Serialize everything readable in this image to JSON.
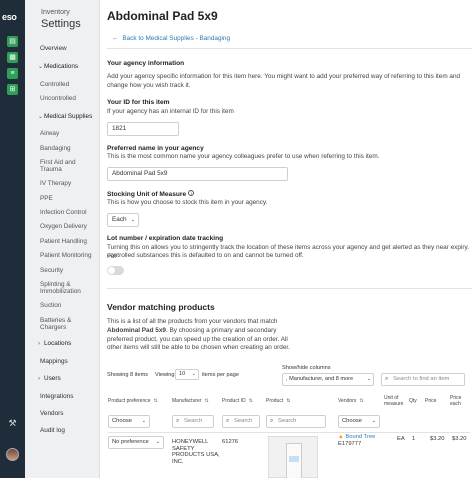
{
  "rail": {
    "logo": "eso",
    "icons": [
      "clipboard-icon",
      "grid-icon",
      "list-icon",
      "cart-icon"
    ]
  },
  "nav": {
    "crumb": "Inventory",
    "title": "Settings",
    "overview": "Overview",
    "medications": "Medications",
    "controlled": "Controlled",
    "uncontrolled": "Uncontrolled",
    "medical_supplies": "Medical Supplies",
    "supplies": [
      "Airway",
      "Bandaging",
      "First Aid and",
      "Trauma",
      "IV Therapy",
      "PPE",
      "Infection Control",
      "Oxygen Delivery",
      "Patient Handling",
      "Patient Monitoring",
      "Security",
      "Splinting &",
      "Immobilization",
      "Suction",
      "Batteries &",
      "Chargers"
    ],
    "locations": "Locations",
    "mappings": "Mappings",
    "users": "Users",
    "integrations": "Integrations",
    "vendors": "Vendors",
    "audit_log": "Audit log"
  },
  "page": {
    "title": "Abdominal Pad 5x9",
    "back_link": "Back to Medical Supplies - Bandaging"
  },
  "agency": {
    "heading": "Your agency information",
    "desc1": "Add your agency specific information for this item here. You might want to add your preferred way of referring to this item and",
    "desc2": "change how you wish track it.",
    "id_label": "Your ID for this item",
    "id_help": "If your agency has an internal ID for this item",
    "id_value": "1821",
    "name_label": "Preferred name in your agency",
    "name_help": "This is the most common name your agency colleagues prefer to use when referring to this item.",
    "name_value": "Abdominal Pad 5x9",
    "stocking_label": "Stocking Unit of Measure",
    "stocking_help": "This is how you choose to stock this item in your agency.",
    "stocking_value": "Each",
    "lot_label": "Lot number / expiration date tracking",
    "lot_help1": "Turning this on allows you to stringently track the location of these items across your agency and get alerted as they near expiry. For",
    "lot_help2": "controlled substances this is defaulted to on and cannot be turned off.",
    "lot_enabled": false
  },
  "vendor": {
    "heading": "Vendor matching products",
    "desc1": "This is a list of all the products from your vendors that match",
    "desc2_bold": "Abdominal Pad 5x9",
    "desc2_rest": ". By choosing a primary and secondary",
    "desc3": "preferred product, you can speed up the creation of an order. All",
    "desc4": "other items will still be able to be chosen when creating an order.",
    "showing": "Showing 8 items",
    "viewing_label": "Viewing",
    "viewing_value": "10",
    "items_per_page": "items per page",
    "showhide_label": "Show/hide columns",
    "showhide_value": ", Manufacturer, and 8 more",
    "search_placeholder": "Search to find an item",
    "columns": {
      "preference": "Product preference",
      "manufacturer": "Manufacturer",
      "product_id": "Product ID",
      "product": "Product",
      "vendors": "Vendors",
      "unit1": "Unit of",
      "unit2": "measure",
      "qty": "Qty",
      "price": "Price",
      "price_each1": "Price",
      "price_each2": "each"
    },
    "filters": {
      "preference": "Choose",
      "search": "Search",
      "vendors": "Choose"
    },
    "rows": [
      {
        "preference": "No preference",
        "manufacturer": [
          "HONEYWELL",
          "SAFETY",
          "PRODUCTS USA,",
          "INC."
        ],
        "product_id": "61276",
        "vendor_name": "Bound Tree",
        "vendor_code": "E179777",
        "unit": "EA",
        "qty": "1",
        "price": "$3.20",
        "price_each": "$3.20"
      }
    ]
  }
}
